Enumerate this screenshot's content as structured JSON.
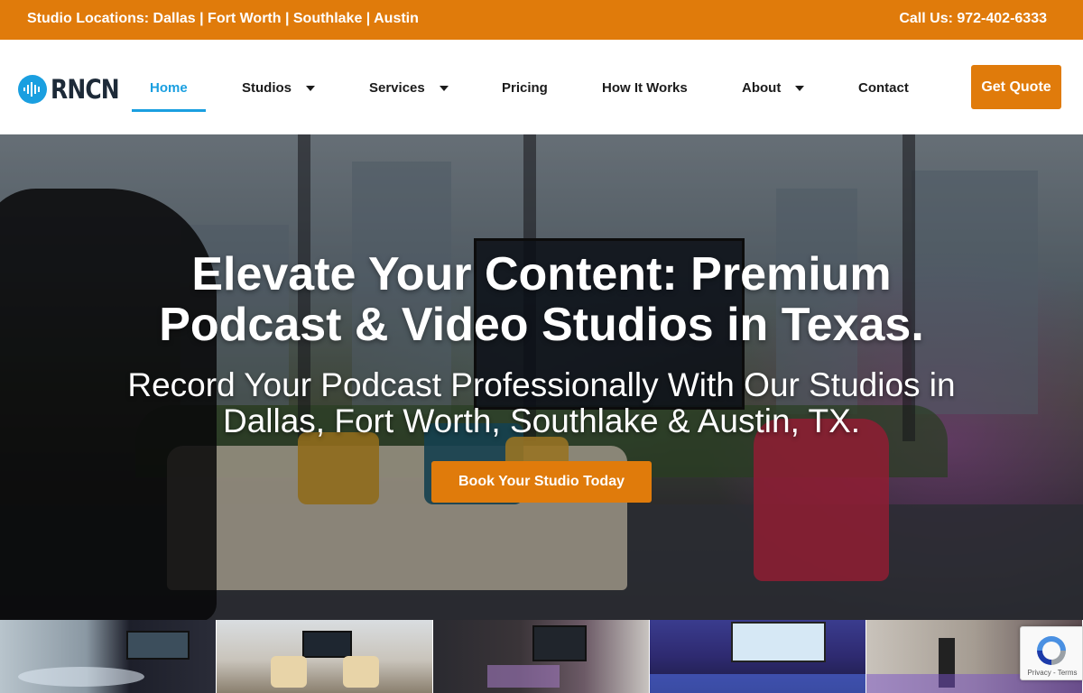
{
  "topbar": {
    "locations": "Studio Locations: Dallas | Fort Worth | Southlake | Austin",
    "phone": "Call Us: 972-402-6333"
  },
  "brand": {
    "name": "RNCN",
    "logo_icon": "soundwave-icon",
    "accent_color": "#1a9fe0",
    "cta_color": "#e07b0b"
  },
  "nav": {
    "items": [
      {
        "label": "Home",
        "active": true
      },
      {
        "label": "Studios",
        "dropdown": true
      },
      {
        "label": "Services",
        "dropdown": true
      },
      {
        "label": "Pricing"
      },
      {
        "label": "How It Works"
      },
      {
        "label": "About",
        "dropdown": true
      },
      {
        "label": "Contact"
      }
    ],
    "quote_button": "Get Quote"
  },
  "hero": {
    "title_line1": "Elevate Your Content: Premium",
    "title_line2": "Podcast & Video Studios in Texas.",
    "subtitle_line1": "Record Your Podcast Professionally With Our Studios in",
    "subtitle_line2": "Dallas, Fort Worth, Southlake & Austin, TX.",
    "cta": "Book Your Studio Today"
  },
  "gallery": {
    "count": 5
  },
  "recaptcha": {
    "links": "Privacy - Terms"
  }
}
